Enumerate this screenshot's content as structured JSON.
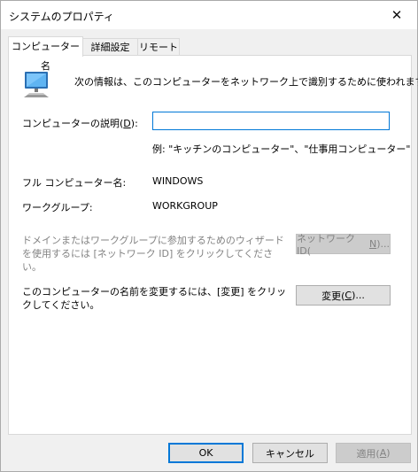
{
  "window": {
    "title": "システムのプロパティ",
    "close_glyph": "✕"
  },
  "tabs": [
    {
      "label": "コンピューター名",
      "active": true
    },
    {
      "label": "詳細設定",
      "active": false
    },
    {
      "label": "リモート",
      "active": false
    }
  ],
  "panel": {
    "intro_text": "次の情報は、このコンピューターをネットワーク上で識別するために使われます。",
    "description_label_prefix": "コンピューターの説明(",
    "description_label_key": "D",
    "description_label_suffix": "):",
    "description_value": "",
    "example_text": "例: \"キッチンのコンピューター\"、\"仕事用コンピューター\"",
    "full_name_label": "フル コンピューター名:",
    "full_name_value": "WINDOWS",
    "workgroup_label": "ワークグループ:",
    "workgroup_value": "WORKGROUP",
    "wizard_text": "ドメインまたはワークグループに参加するためのウィザードを使用するには [ネットワーク ID] をクリックしてください。",
    "network_id_button_prefix": "ネットワーク ID(",
    "network_id_button_key": "N",
    "network_id_button_suffix": ")...",
    "rename_text": "このコンピューターの名前を変更するには、[変更] をクリックしてください。",
    "change_button_prefix": "変更(",
    "change_button_key": "C",
    "change_button_suffix": ")..."
  },
  "footer": {
    "ok_label": "OK",
    "cancel_label": "キャンセル",
    "apply_prefix": "適用(",
    "apply_key": "A",
    "apply_suffix": ")"
  },
  "colors": {
    "focus_accent": "#0078d7",
    "disabled_text": "#838383",
    "button_face": "#e1e1e1",
    "window_bg": "#f0f0f0",
    "panel_bg": "#ffffff"
  },
  "icons": {
    "close": "close-icon",
    "computer": "computer-monitor-icon"
  }
}
